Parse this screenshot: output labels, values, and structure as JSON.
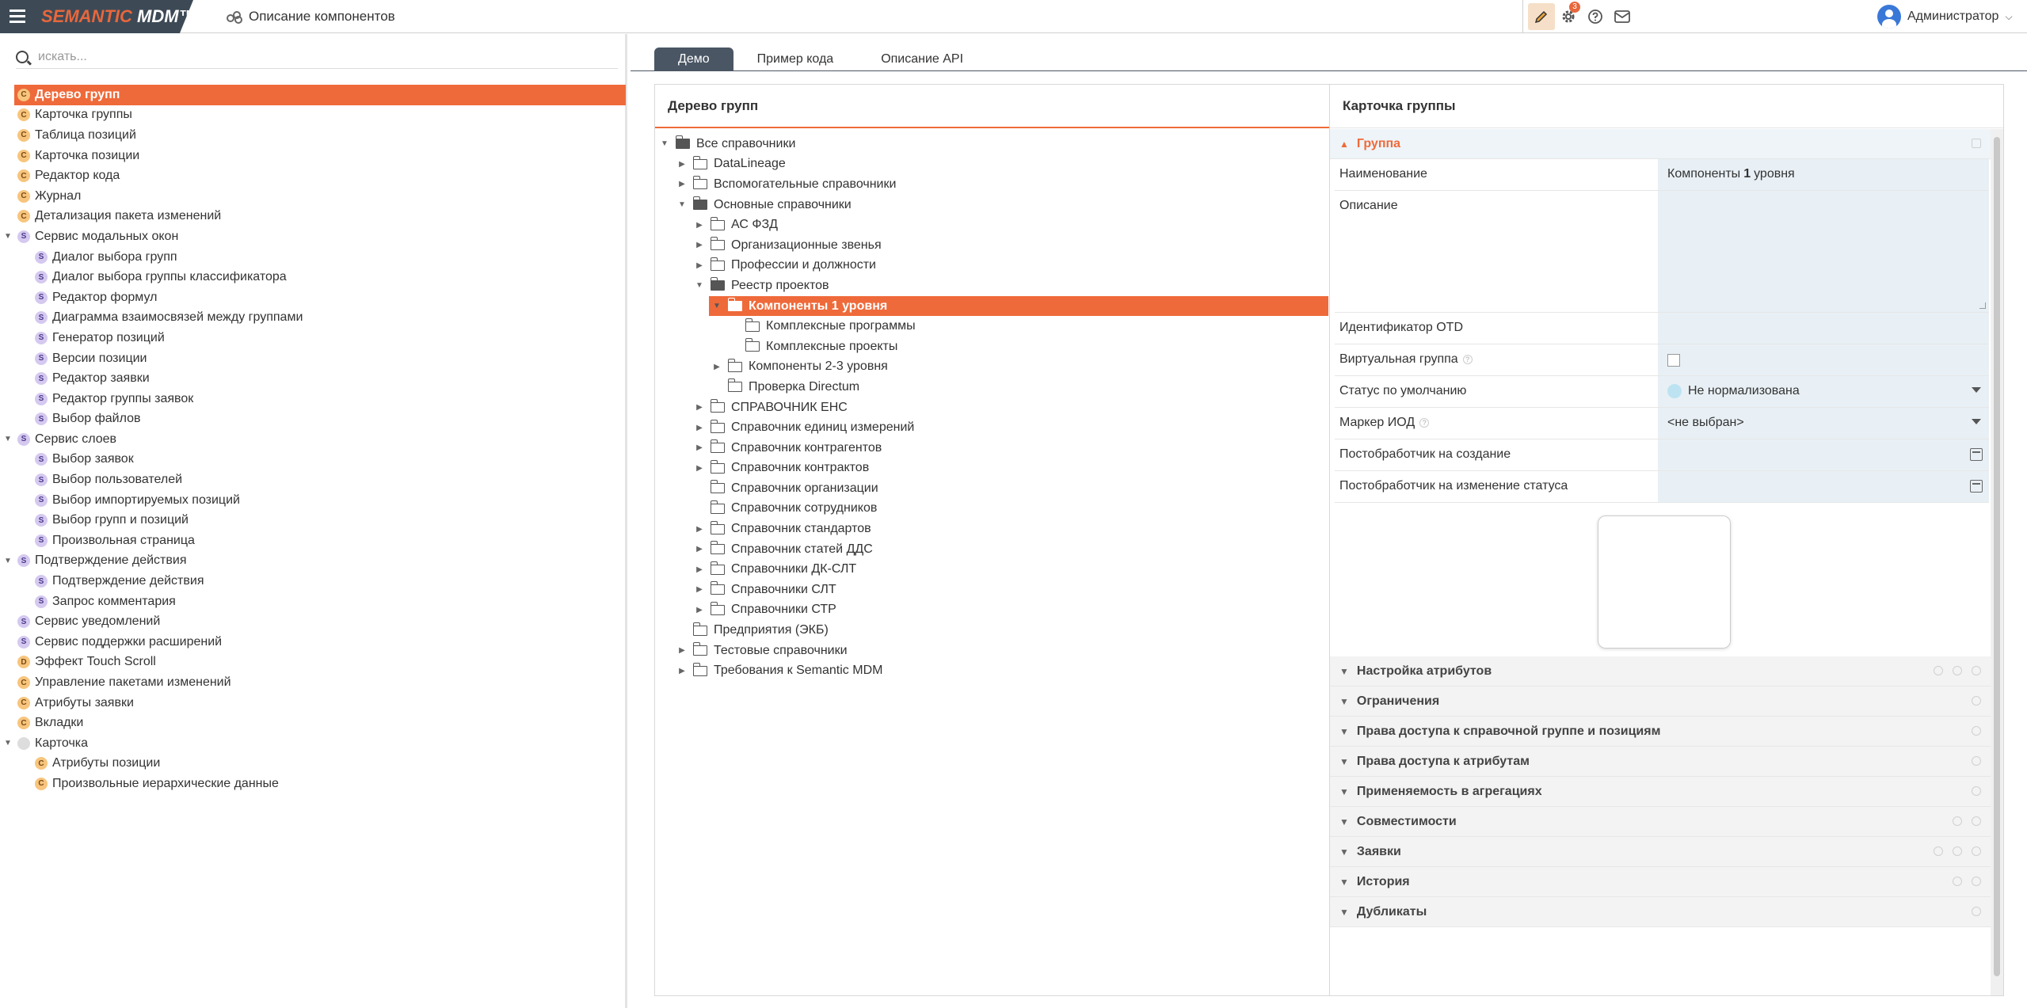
{
  "header": {
    "brand_semantic": "SEMANTIC ",
    "brand_mdm": "MDM™",
    "page_title": "Описание компонентов",
    "notifications_count": "3",
    "user_name": "Администратор"
  },
  "search": {
    "placeholder": "искать..."
  },
  "components": [
    {
      "label": "Дерево групп",
      "kind": "C",
      "level": 1,
      "selected": true
    },
    {
      "label": "Карточка группы",
      "kind": "C",
      "level": 1
    },
    {
      "label": "Таблица позиций",
      "kind": "C",
      "level": 1
    },
    {
      "label": "Карточка позиции",
      "kind": "C",
      "level": 1
    },
    {
      "label": "Редактор кода",
      "kind": "C",
      "level": 1
    },
    {
      "label": "Журнал",
      "kind": "C",
      "level": 1
    },
    {
      "label": "Детализация пакета изменений",
      "kind": "C",
      "level": 1
    },
    {
      "label": "Сервис модальных окон",
      "kind": "S",
      "level": 0,
      "expanded": true
    },
    {
      "label": "Диалог выбора групп",
      "kind": "S",
      "level": 2
    },
    {
      "label": "Диалог выбора группы классификатора",
      "kind": "S",
      "level": 2
    },
    {
      "label": "Редактор формул",
      "kind": "S",
      "level": 2
    },
    {
      "label": "Диаграмма взаимосвязей между группами",
      "kind": "S",
      "level": 2
    },
    {
      "label": "Генератор позиций",
      "kind": "S",
      "level": 2
    },
    {
      "label": "Версии позиции",
      "kind": "S",
      "level": 2
    },
    {
      "label": "Редактор заявки",
      "kind": "S",
      "level": 2
    },
    {
      "label": "Редактор группы заявок",
      "kind": "S",
      "level": 2
    },
    {
      "label": "Выбор файлов",
      "kind": "S",
      "level": 2
    },
    {
      "label": "Сервис слоев",
      "kind": "S",
      "level": 0,
      "expanded": true
    },
    {
      "label": "Выбор заявок",
      "kind": "S",
      "level": 2
    },
    {
      "label": "Выбор пользователей",
      "kind": "S",
      "level": 2
    },
    {
      "label": "Выбор импортируемых позиций",
      "kind": "S",
      "level": 2
    },
    {
      "label": "Выбор групп и позиций",
      "kind": "S",
      "level": 2
    },
    {
      "label": "Произвольная страница",
      "kind": "S",
      "level": 2
    },
    {
      "label": "Подтверждение действия",
      "kind": "S",
      "level": 0,
      "expanded": true
    },
    {
      "label": "Подтверждение действия",
      "kind": "S",
      "level": 2
    },
    {
      "label": "Запрос комментария",
      "kind": "S",
      "level": 2
    },
    {
      "label": "Сервис уведомлений",
      "kind": "S",
      "level": 1
    },
    {
      "label": "Сервис поддержки расширений",
      "kind": "S",
      "level": 1
    },
    {
      "label": "Эффект Touch Scroll",
      "kind": "D",
      "level": 1
    },
    {
      "label": "Управление пакетами изменений",
      "kind": "C",
      "level": 1
    },
    {
      "label": "Атрибуты заявки",
      "kind": "C",
      "level": 1
    },
    {
      "label": "Вкладки",
      "kind": "C",
      "level": 1
    },
    {
      "label": "Карточка",
      "kind": "N",
      "level": 0,
      "expanded": true
    },
    {
      "label": "Атрибуты позиции",
      "kind": "C",
      "level": 2
    },
    {
      "label": "Произвольные иерархические данные",
      "kind": "C",
      "level": 2
    }
  ],
  "tabs": [
    "Демо",
    "Пример кода",
    "Описание API"
  ],
  "tree_panel": {
    "title": "Дерево групп",
    "nodes": [
      {
        "label": "Все справочники",
        "depth": 0,
        "arrow": "down",
        "open": true
      },
      {
        "label": "DataLineage",
        "depth": 1,
        "arrow": "right"
      },
      {
        "label": "Вспомогательные справочники",
        "depth": 1,
        "arrow": "right"
      },
      {
        "label": "Основные справочники",
        "depth": 1,
        "arrow": "down",
        "open": true
      },
      {
        "label": "АС ФЗД",
        "depth": 2,
        "arrow": "right"
      },
      {
        "label": "Организационные звенья",
        "depth": 2,
        "arrow": "right"
      },
      {
        "label": "Профессии и должности",
        "depth": 2,
        "arrow": "right"
      },
      {
        "label": "Реестр проектов",
        "depth": 2,
        "arrow": "down",
        "open": true
      },
      {
        "label": "Компоненты 1 уровня",
        "depth": 3,
        "arrow": "down",
        "open": true,
        "selected": true
      },
      {
        "label": "Комплексные программы",
        "depth": 4,
        "arrow": ""
      },
      {
        "label": "Комплексные проекты",
        "depth": 4,
        "arrow": ""
      },
      {
        "label": "Компоненты 2-3 уровня",
        "depth": 3,
        "arrow": "right"
      },
      {
        "label": "Проверка Directum",
        "depth": 3,
        "arrow": ""
      },
      {
        "label": "СПРАВОЧНИК ЕНС",
        "depth": 2,
        "arrow": "right"
      },
      {
        "label": "Справочник единиц измерений",
        "depth": 2,
        "arrow": "right"
      },
      {
        "label": "Справочник контрагентов",
        "depth": 2,
        "arrow": "right"
      },
      {
        "label": "Справочник контрактов",
        "depth": 2,
        "arrow": "right"
      },
      {
        "label": "Справочник организации",
        "depth": 2,
        "arrow": ""
      },
      {
        "label": "Справочник сотрудников",
        "depth": 2,
        "arrow": ""
      },
      {
        "label": "Справочник стандартов",
        "depth": 2,
        "arrow": "right"
      },
      {
        "label": "Справочник статей ДДС",
        "depth": 2,
        "arrow": "right"
      },
      {
        "label": "Справочники ДК-СЛТ",
        "depth": 2,
        "arrow": "right"
      },
      {
        "label": "Справочники СЛТ",
        "depth": 2,
        "arrow": "right"
      },
      {
        "label": "Справочники СТР",
        "depth": 2,
        "arrow": "right"
      },
      {
        "label": "Предприятия (ЭКБ)",
        "depth": 1,
        "arrow": ""
      },
      {
        "label": "Тестовые справочники",
        "depth": 1,
        "arrow": "right"
      },
      {
        "label": "Требования к Semantic MDM",
        "depth": 1,
        "arrow": "right"
      }
    ]
  },
  "card_panel": {
    "title": "Карточка группы",
    "group_section": "Группа",
    "fields": {
      "name_label": "Наименование",
      "name_value_prefix": "Компоненты ",
      "name_value_bold": "1",
      "name_value_suffix": " уровня",
      "description_label": "Описание",
      "otd_label": "Идентификатор OTD",
      "virtual_label": "Виртуальная группа",
      "status_label": "Статус по умолчанию",
      "status_value": "Не нормализована",
      "marker_label": "Маркер ИОД",
      "marker_value": "<не выбран>",
      "post_create_label": "Постобработчик на создание",
      "post_status_label": "Постобработчик на изменение статуса"
    },
    "sections": [
      "Настройка атрибутов",
      "Ограничения",
      "Права доступа к справочной группе и позициям",
      "Права доступа к атрибутам",
      "Применяемость в агрегациях",
      "Совместимости",
      "Заявки",
      "История",
      "Дубликаты"
    ]
  },
  "colors": {
    "accent": "#ef6a3a",
    "brand_bg": "#3d4a56",
    "field_bg": "#e8f0f5"
  }
}
